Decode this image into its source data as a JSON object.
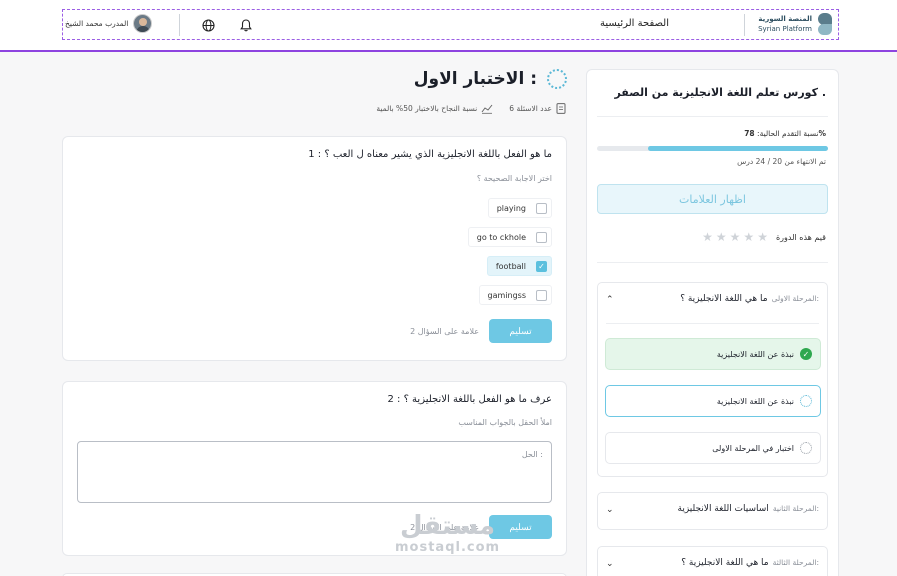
{
  "header": {
    "brand_ar": "المنصة السورية",
    "brand_en": "Syrian Platform",
    "home_link": "الصفحة الرئيسية",
    "trainer_name": "المدرب محمد الشيخ"
  },
  "quiz": {
    "title": "الاختبار الاول :",
    "questions_count": "عدد الاسئلة 6",
    "pass_rate": "نسبة النجاح بالاختبار 50% بالمية"
  },
  "question1": {
    "text": "1 : ما هو الفعل باللغة الانجليزية الذي يشير معناه ل العب ؟",
    "hint": "اختر الاجابة الصحيحة ؟",
    "options": [
      {
        "label": "playing",
        "checked": false
      },
      {
        "label": "go to ckhole",
        "checked": false
      },
      {
        "label": "football",
        "checked": true
      },
      {
        "label": "gamingss",
        "checked": false
      }
    ],
    "submit_label": "تسليم",
    "points": "2 علامة على السؤال"
  },
  "question2": {
    "text": "2 : عرف ما هو الفعل باللغة الانجليزية ؟",
    "hint": "املأ الحقل بالجواب المناسب",
    "answer_label": "الحل :",
    "submit_label": "تسليم",
    "points": "2 علامة على السؤال"
  },
  "sidebar": {
    "course_title": "كورس تعلم اللغة الانجليزية من الصفر .",
    "progress_label": "نسبة التقدم الحالية:",
    "progress_value": "78%",
    "progress_fraction": 0.78,
    "progress_note": "تم الانتهاء من 20 / 24 درس",
    "grades_button": "اظهار العلامات",
    "rate_label": "قيم هذه الدورة",
    "stages": [
      {
        "number": "المرحلة الاولى:",
        "title": "ما هي اللغة الانجليزية ؟",
        "lessons": [
          {
            "label": "نبذة عن اللغة الانجليزية",
            "status": "done"
          },
          {
            "label": "نبذة عن اللغة الانجليزية",
            "status": "active"
          },
          {
            "label": "اختبار في المرحلة الاولى",
            "status": "todo"
          }
        ]
      },
      {
        "number": "المرحلة الثانية:",
        "title": "اساسيات اللغة الانجليزية"
      },
      {
        "number": "المرحلة الثالثة:",
        "title": "ما هي اللغة الانجليزية ؟"
      }
    ]
  },
  "watermark": {
    "ar": "مستقل",
    "en": "mostaql.com"
  },
  "colors": {
    "accent": "#6ec8e4",
    "header_border": "#8e44e0",
    "success": "#2fa84f"
  }
}
